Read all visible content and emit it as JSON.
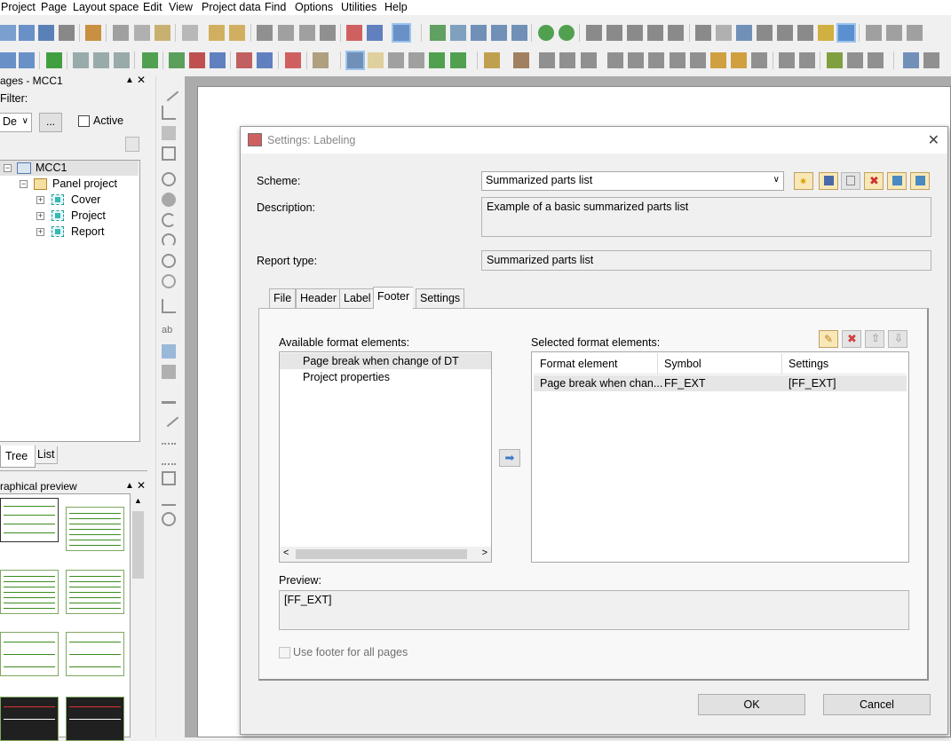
{
  "menu": [
    "Project",
    "Page",
    "Layout space",
    "Edit",
    "View",
    "Project data",
    "Find",
    "Options",
    "Utilities",
    "Help"
  ],
  "pages_panel": {
    "title": "ages - MCC1",
    "filter_label": "Filter:",
    "filter_value": "De",
    "more_label": "...",
    "active_label": "Active",
    "tree": {
      "root": "MCC1",
      "project": "Panel project",
      "children": [
        "Cover",
        "Project",
        "Report"
      ]
    },
    "tabs": [
      "Tree",
      "List"
    ]
  },
  "preview_panel": {
    "title": "raphical preview"
  },
  "dialog": {
    "title": "Settings: Labeling",
    "scheme_label": "Scheme:",
    "scheme_value": "Summarized parts list",
    "description_label": "Description:",
    "description_value": "Example of a basic summarized parts list",
    "report_type_label": "Report type:",
    "report_type_value": "Summarized parts list",
    "tabs": [
      "File",
      "Header",
      "Label",
      "Footer",
      "Settings"
    ],
    "active_tab": "Footer",
    "available_label": "Available format elements:",
    "available_items": [
      "Page break when change of DT",
      "Project properties"
    ],
    "selected_label": "Selected format elements:",
    "selected_columns": [
      "Format element",
      "Symbol",
      "Settings"
    ],
    "selected_rows": [
      {
        "format_element": "Page break when chan...",
        "symbol": "FF_EXT",
        "settings": "[FF_EXT]"
      }
    ],
    "preview_label": "Preview:",
    "preview_value": "[FF_EXT]",
    "use_footer_label": "Use footer for all pages",
    "ok_label": "OK",
    "cancel_label": "Cancel"
  },
  "colors": {
    "accent_green": "#3c8c20",
    "selection": "#e6e6e6"
  }
}
